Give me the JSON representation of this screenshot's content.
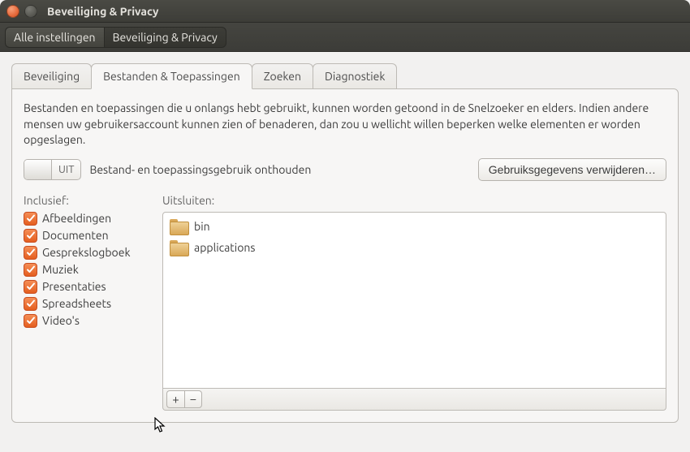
{
  "window": {
    "title": "Beveiliging & Privacy"
  },
  "breadcrumb": {
    "all_settings": "Alle instellingen",
    "current": "Beveiliging & Privacy"
  },
  "tabs": {
    "security": "Beveiliging",
    "files_apps": "Bestanden & Toepassingen",
    "search": "Zoeken",
    "diagnostic": "Diagnostiek"
  },
  "pane": {
    "description": "Bestanden en toepassingen die u onlangs hebt gebruikt, kunnen worden getoond in de Snelzoeker en elders. Indien andere mensen uw gebruikersaccount kunnen zien of benaderen, dan zou u wellicht willen beperken welke elementen er worden opgeslagen.",
    "toggle_state": "UIT",
    "toggle_label": "Bestand- en toepassingsgebruik onthouden",
    "clear_button": "Gebruiksgegevens verwijderen…",
    "include_label": "Inclusief:",
    "exclude_label": "Uitsluiten:",
    "include_items": [
      "Afbeeldingen",
      "Documenten",
      "Gesprekslogboek",
      "Muziek",
      "Presentaties",
      "Spreadsheets",
      "Video's"
    ],
    "exclude_items": [
      "bin",
      "applications"
    ]
  }
}
